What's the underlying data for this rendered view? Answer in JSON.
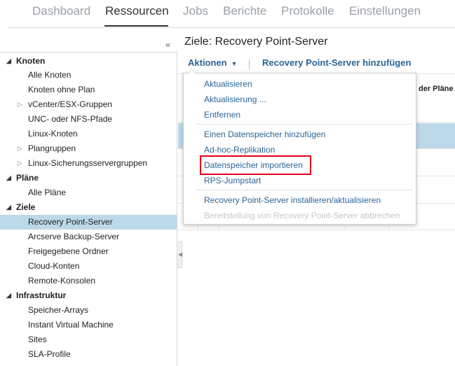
{
  "nav": {
    "tabs": [
      {
        "label": "Dashboard",
        "active": false
      },
      {
        "label": "Ressourcen",
        "active": true
      },
      {
        "label": "Jobs",
        "active": false
      },
      {
        "label": "Berichte",
        "active": false
      },
      {
        "label": "Protokolle",
        "active": false
      },
      {
        "label": "Einstellungen",
        "active": false
      }
    ]
  },
  "sidebar": {
    "collapse_icon": "double-chevron-left-icon",
    "groups": [
      {
        "label": "Knoten",
        "items": [
          {
            "label": "Alle Knoten",
            "expandable": false
          },
          {
            "label": "Knoten ohne Plan",
            "expandable": false
          },
          {
            "label": "vCenter/ESX-Gruppen",
            "expandable": true
          },
          {
            "label": "UNC- oder NFS-Pfade",
            "expandable": false
          },
          {
            "label": "Linux-Knoten",
            "expandable": false
          },
          {
            "label": "Plangruppen",
            "expandable": true
          },
          {
            "label": "Linux-Sicherungsservergruppen",
            "expandable": true
          }
        ]
      },
      {
        "label": "Pläne",
        "items": [
          {
            "label": "Alle Pläne",
            "expandable": false
          }
        ]
      },
      {
        "label": "Ziele",
        "items": [
          {
            "label": "Recovery Point-Server",
            "expandable": false,
            "selected": true
          },
          {
            "label": "Arcserve Backup-Server",
            "expandable": false
          },
          {
            "label": "Freigegebene Ordner",
            "expandable": false
          },
          {
            "label": "Cloud-Konten",
            "expandable": false
          },
          {
            "label": "Remote-Konsolen",
            "expandable": false
          }
        ]
      },
      {
        "label": "Infrastruktur",
        "items": [
          {
            "label": "Speicher-Arrays",
            "expandable": false
          },
          {
            "label": "Instant Virtual Machine",
            "expandable": false
          },
          {
            "label": "Sites",
            "expandable": false
          },
          {
            "label": "SLA-Profile",
            "expandable": false
          }
        ]
      }
    ]
  },
  "main": {
    "title": "Ziele: Recovery Point-Server",
    "toolbar": {
      "actions_label": "Aktionen",
      "add_rps_label": "Recovery Point-Server hinzufügen"
    },
    "grid": {
      "column_header_fragment": "der Pläne"
    }
  },
  "dropdown": {
    "groups": [
      [
        {
          "label": "Aktualisieren",
          "enabled": true
        },
        {
          "label": "Aktualisierung ...",
          "enabled": true
        },
        {
          "label": "Entfernen",
          "enabled": true
        }
      ],
      [
        {
          "label": "Einen Datenspeicher hinzufügen",
          "enabled": true
        },
        {
          "label": "Ad-hoc-Replikation",
          "enabled": true
        },
        {
          "label": "Datenspeicher importieren",
          "enabled": true,
          "highlighted": true
        },
        {
          "label": "RPS-Jumpstart",
          "enabled": true
        }
      ],
      [
        {
          "label": "Recovery Point-Server installieren/aktualisieren",
          "enabled": true
        },
        {
          "label": "Bereitstellung von Recovery Point-Server abbrechen",
          "enabled": false
        }
      ]
    ]
  },
  "colors": {
    "link": "#2a6496",
    "selection": "#bcd9ea",
    "highlight_border": "#e3001b",
    "disabled": "#c8c8c8"
  }
}
